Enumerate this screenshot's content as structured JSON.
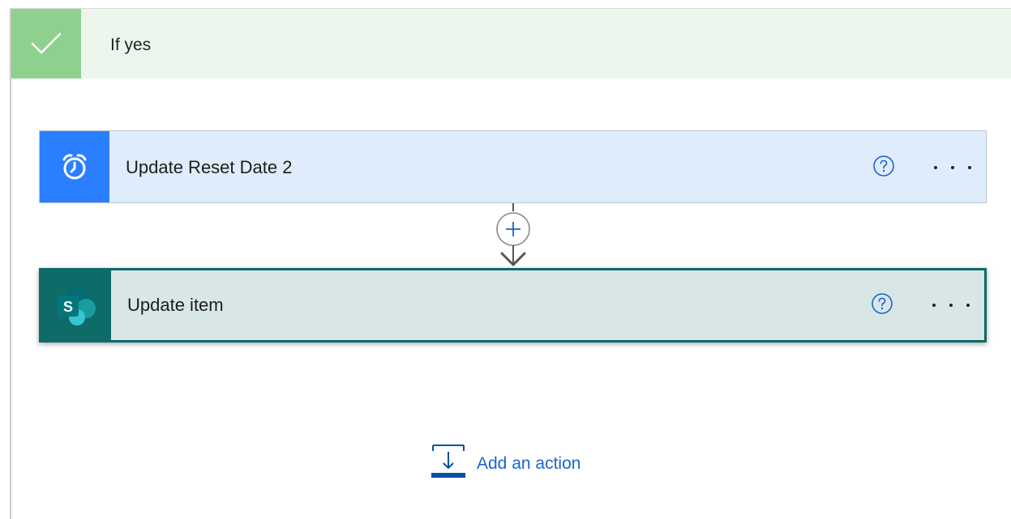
{
  "branch": {
    "title": "If yes",
    "check_icon": "check-icon",
    "accent_color": "#8ed08e"
  },
  "actions": [
    {
      "title": "Update Reset Date 2",
      "icon": "alarm-clock-icon",
      "icon_color": "#2a7fff"
    },
    {
      "title": "Update item",
      "icon": "sharepoint-icon",
      "icon_color": "#0f6b68",
      "icon_letter": "S"
    }
  ],
  "connector": {
    "icon": "plus-icon"
  },
  "add_action": {
    "label": "Add an action",
    "icon": "add-action-icon"
  }
}
